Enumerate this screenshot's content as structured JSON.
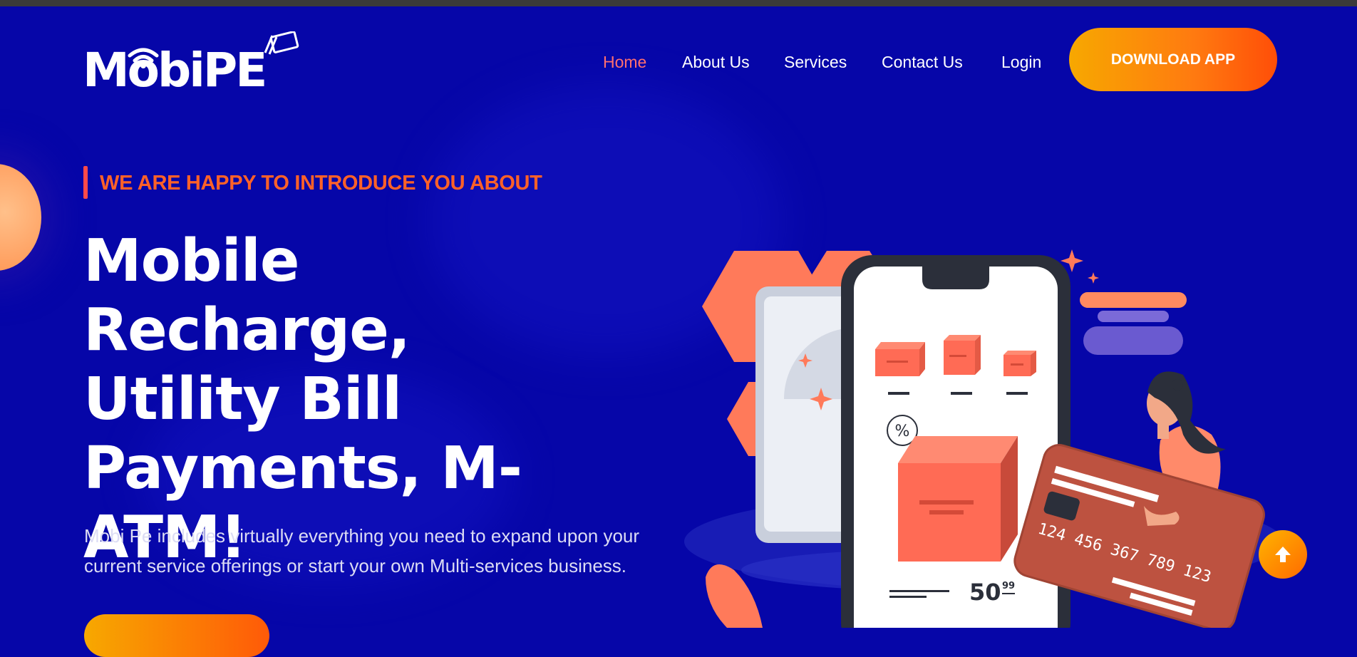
{
  "brand": {
    "name": "MobiPE"
  },
  "nav": {
    "items": [
      {
        "label": "Home",
        "active": true
      },
      {
        "label": "About Us"
      },
      {
        "label": "Services"
      },
      {
        "label": "Contact Us"
      },
      {
        "label": "Login"
      }
    ],
    "download_label": "DOWNLOAD APP"
  },
  "hero": {
    "intro": "WE ARE HAPPY TO INTRODUCE YOU ABOUT",
    "title_lines": [
      "Mobile Recharge,",
      "Utility Bill",
      "Payments, M-",
      "ATM!"
    ],
    "description_lines": [
      "Mobi Pe includes virtually everything you need to expand upon your",
      "current service offerings or start your own Multi-services business."
    ]
  },
  "illustration": {
    "price_main": "50",
    "price_cents": "99",
    "card_number": "124 456 367 789 123",
    "discount_symbol": "%"
  },
  "colors": {
    "background": "#0606a8",
    "accent_orange": "#ff6128",
    "active_nav": "#ff6f6f",
    "button_gradient_start": "#f7a800",
    "button_gradient_end": "#ff4e08"
  },
  "icons": {
    "scroll_top": "arrow-up-icon"
  }
}
